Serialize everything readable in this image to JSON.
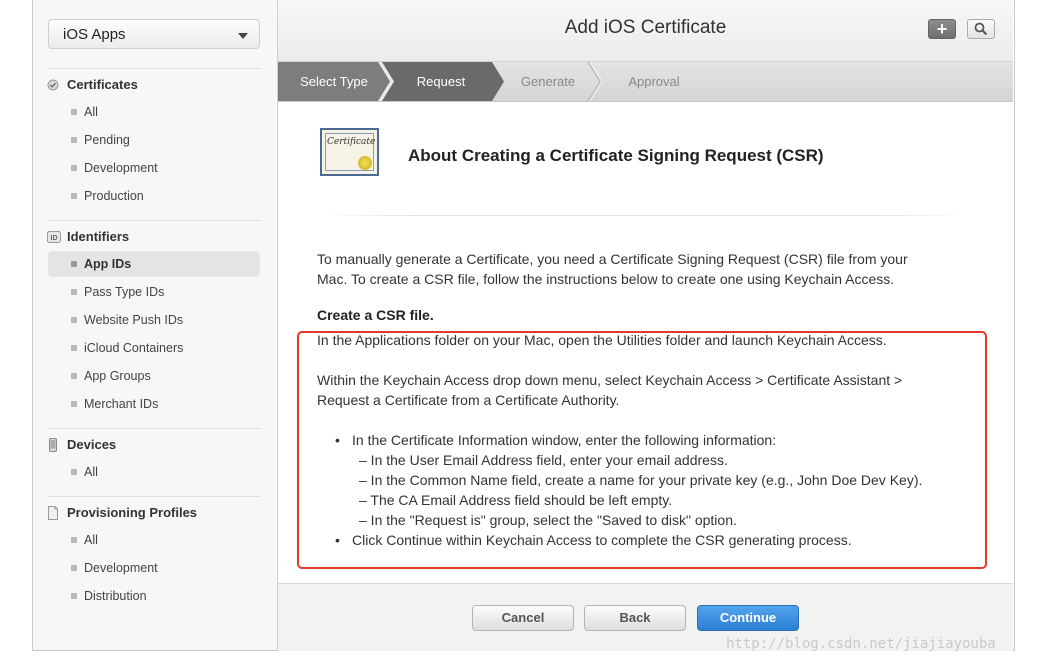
{
  "sidebar": {
    "app_select": "iOS Apps",
    "sections": [
      {
        "title": "Certificates",
        "items": [
          "All",
          "Pending",
          "Development",
          "Production"
        ]
      },
      {
        "title": "Identifiers",
        "badge": "ID",
        "items": [
          "App IDs",
          "Pass Type IDs",
          "Website Push IDs",
          "iCloud Containers",
          "App Groups",
          "Merchant IDs"
        ]
      },
      {
        "title": "Devices",
        "items": [
          "All"
        ]
      },
      {
        "title": "Provisioning Profiles",
        "items": [
          "All",
          "Development",
          "Distribution"
        ]
      }
    ]
  },
  "header": {
    "title": "Add iOS Certificate",
    "plus_glyph": "+",
    "search_icon": "search-icon"
  },
  "steps": [
    "Select Type",
    "Request",
    "Generate",
    "Approval"
  ],
  "content": {
    "cert_icon_text": "Certificate",
    "title": "About Creating a Certificate Signing Request (CSR)",
    "intro_line1": "To manually generate a Certificate, you need a Certificate Signing Request (CSR) file from your",
    "intro_line2": "Mac. To create a CSR file, follow the instructions below to create one using Keychain Access.",
    "csr_heading": "Create a CSR file.",
    "step_line": "In the Applications folder on your Mac, open the Utilities folder and launch Keychain Access.",
    "menu_line1": "Within the Keychain Access drop down menu, select Keychain Access > Certificate Assistant >",
    "menu_line2": "Request a Certificate from a Certificate Authority.",
    "bullet1": "In the Certificate Information window, enter the following information:",
    "sub1": "– In the User Email Address field, enter your email address.",
    "sub2": "– In the Common Name field, create a name for your private key (e.g., John Doe Dev Key).",
    "sub3": "– The CA Email Address field should be left empty.",
    "sub4": "– In the \"Request is\" group, select the \"Saved to disk\" option.",
    "bullet2": "Click Continue within Keychain Access to complete the CSR generating process."
  },
  "footer": {
    "cancel": "Cancel",
    "back": "Back",
    "continue": "Continue"
  },
  "watermark": "http://blog.csdn.net/jiajiayouba",
  "colors": {
    "accent_blue": "#2b7fd2",
    "highlight_red": "#e23a2b"
  }
}
